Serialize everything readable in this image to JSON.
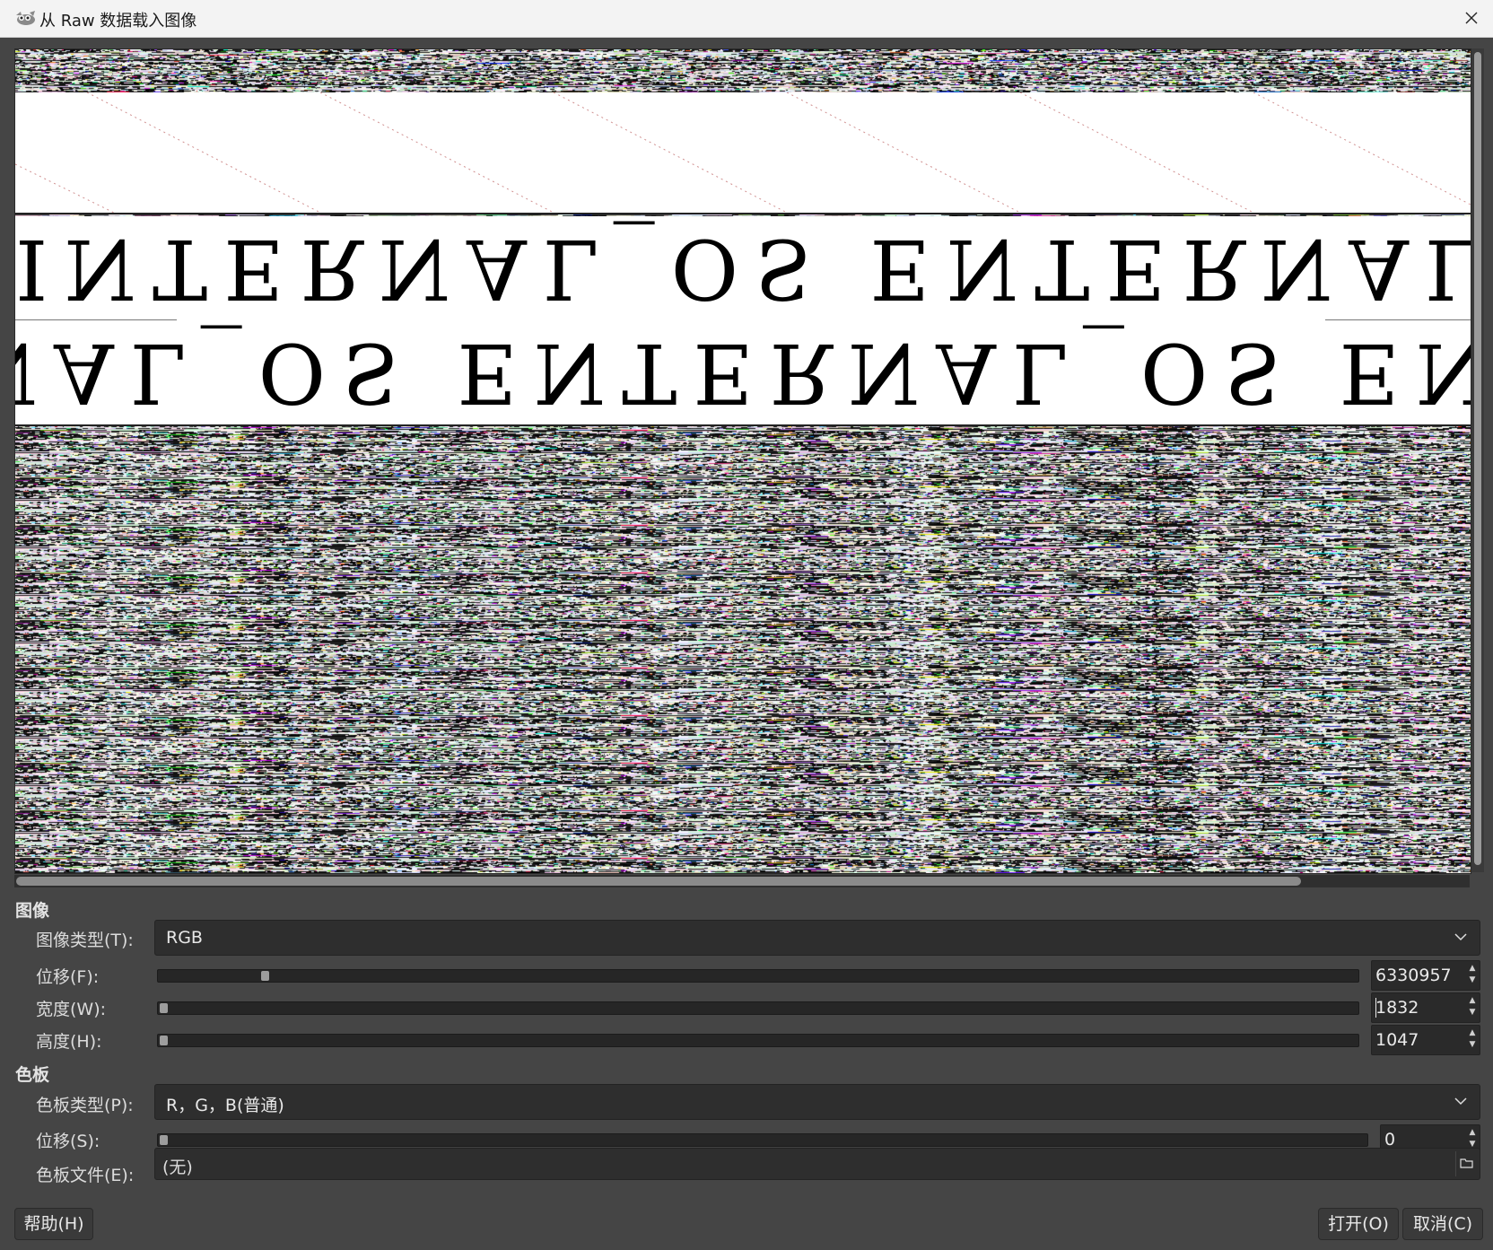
{
  "window": {
    "title": "从 Raw 数据载入图像",
    "app_icon": "gimp-wilber-icon",
    "close_icon": "close-icon"
  },
  "preview": {
    "mirrored_text": "INTERNAL_OS ENTERNAL_OS ENTERNAL_OS"
  },
  "image_section": {
    "heading": "图像",
    "image_type_label": "图像类型(T):",
    "image_type_value": "RGB",
    "offset_label": "位移(F):",
    "offset_value": "6330957",
    "offset_fraction": 0.085,
    "width_label": "宽度(W):",
    "width_value": "1832",
    "width_fraction": 0.0,
    "height_label": "高度(H):",
    "height_value": "1047",
    "height_fraction": 0.0
  },
  "palette_section": {
    "heading": "色板",
    "palette_type_label": "色板类型(P):",
    "palette_type_value": "R，G，B(普通)",
    "palette_offset_label": "位移(S):",
    "palette_offset_value": "0",
    "palette_offset_fraction": 0.0,
    "palette_file_label": "色板文件(E):",
    "palette_file_value": "(无)"
  },
  "buttons": {
    "help": "帮助(H)",
    "open": "打开(O)",
    "cancel": "取消(C)"
  },
  "colors": {
    "dialog_bg": "#454545",
    "titlebar_bg": "#f3f3f3",
    "field_bg": "#2e2e2e"
  }
}
